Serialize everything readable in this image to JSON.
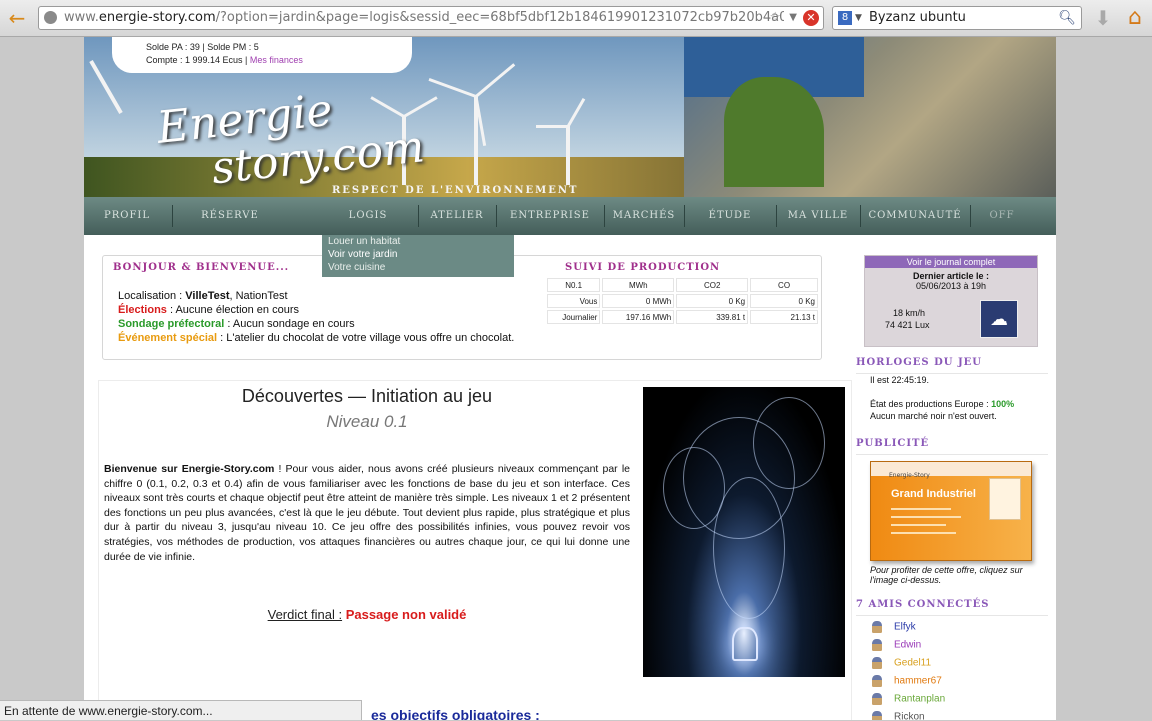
{
  "browser": {
    "url_prefix": "www.",
    "url_domain": "energie-story.com",
    "url_rest": "/?option=jardin&page=logis&sessid_eec=68bf5dbf12b184619901231072cb97b20b4a0",
    "search_query": "Byzanz ubuntu",
    "status_text": "En attente de www.energie-story.com..."
  },
  "account": {
    "line1": "Solde PA : 39 | Solde PM : 5",
    "line2_prefix": "Compte : 1 999.14 Ecus | ",
    "finances_link": "Mes finances"
  },
  "banner": {
    "logo_line1": "Energie",
    "logo_line2": "story.com",
    "tagline": "RESPECT DE L'ENVIRONNEMENT"
  },
  "nav": {
    "items": [
      "PROFIL",
      "RÉSERVE",
      "LOGIS",
      "ATELIER",
      "ENTREPRISE",
      "MARCHÉS",
      "ÉTUDE",
      "MA VILLE",
      "COMMUNAUTÉ",
      "OFF"
    ]
  },
  "submenu": {
    "items": [
      "Louer un habitat",
      "Voir votre jardin",
      "Votre cuisine"
    ]
  },
  "welcome": {
    "heading": "BONJOUR & BIENVENUE...",
    "loc_label": "Localisation : ",
    "loc_town": "VilleTest",
    "loc_nation": ", NationTest",
    "elections_label": "Élections",
    "elections_value": " : Aucune élection en cours",
    "sondage_label": "Sondage préfectoral",
    "sondage_value": " : Aucun sondage en cours",
    "event_label": "Événement spécial",
    "event_value": " : L'atelier du chocolat de votre village vous offre un chocolat."
  },
  "production": {
    "heading": "SUIVI DE PRODUCTION",
    "headers": [
      "N0.1",
      "MWh",
      "CO2",
      "CO"
    ],
    "rows": [
      [
        "Vous",
        "0 MWh",
        "0 Kg",
        "0 Kg"
      ],
      [
        "Journalier",
        "197.16 MWh",
        "339.81 t",
        "21.13 t"
      ]
    ]
  },
  "main": {
    "title": "Découvertes — Initiation au jeu",
    "subtitle": "Niveau 0.1",
    "intro_bold": "Bienvenue sur Energie-Story.com",
    "intro_text": " ! Pour vous aider, nous avons créé plusieurs niveaux commençant par le chiffre 0 (0.1, 0.2, 0.3 et 0.4) afin de vous familiariser avec les fonctions de base du jeu et son interface. Ces niveaux sont très courts et chaque objectif peut être atteint de manière très simple. Les niveaux 1 et 2 présentent des fonctions un peu plus avancées, c'est là que le jeu débute. Tout devient plus rapide, plus stratégique et plus dur à partir du niveau 3, jusqu'au niveau 10. Ce jeu offre des possibilités infinies, vous pouvez revoir vos stratégies, vos méthodes de production, vos attaques financières ou autres chaque jour, ce qui lui donne une durée de vie infinie.",
    "verdict_label": "Verdict final :",
    "verdict_value": "Passage non validé",
    "objectives_heading": "es objectifs obligatoires :"
  },
  "sidebar": {
    "journal_link": "Voir le journal complet",
    "last_article": "Dernier article le :",
    "article_date": "05/06/2013 à 19h",
    "wind": "18 km/h",
    "lux": "74 421 Lux",
    "clocks_heading": "HORLOGES DU JEU",
    "clock_time": "Il est 22:45:19.",
    "prod_state_label": "État des productions Europe : ",
    "prod_state_value": "100%",
    "black_market": "Aucun marché noir n'est ouvert.",
    "ad_heading": "PUBLICITÉ",
    "ad_title": "Grand Industriel",
    "ad_brand": "Energie-Story",
    "ad_caption": "Pour profiter de cette offre, cliquez sur l'image ci-dessus.",
    "friends_heading": "7 AMIS CONNECTÉS",
    "friends": [
      {
        "name": "Elfyk",
        "color": "#2a3aa8"
      },
      {
        "name": "Edwin",
        "color": "#9a3ab8"
      },
      {
        "name": "Gedel11",
        "color": "#d8a020"
      },
      {
        "name": "hammer67",
        "color": "#e07a10"
      },
      {
        "name": "Rantanplan",
        "color": "#6aa83a"
      },
      {
        "name": "Rickon",
        "color": "#555555"
      }
    ]
  },
  "colors": {
    "accent": "#a0308c",
    "nav": "#55716c",
    "red": "#d81c1c",
    "green": "#2a9a2a",
    "orange": "#e89b10"
  }
}
